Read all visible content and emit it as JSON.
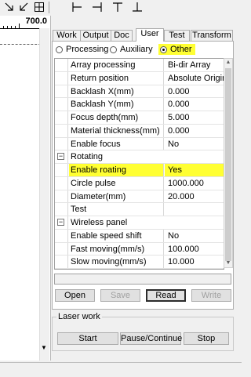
{
  "toolbar": {
    "icons": [
      "arrow-down-right-icon",
      "arrow-down-left-icon",
      "grid-icon",
      "align-left-icon",
      "align-right-icon",
      "align-top-icon",
      "align-bottom-icon"
    ]
  },
  "canvas": {
    "ruler_label": "700.0"
  },
  "tabs": [
    {
      "label": "Work"
    },
    {
      "label": "Output"
    },
    {
      "label": "Doc"
    },
    {
      "label": "User"
    },
    {
      "label": "Test"
    },
    {
      "label": "Transform"
    }
  ],
  "active_tab": "User",
  "radios": {
    "processing": "Processing",
    "auxiliary": "Auxiliary",
    "other": "Other",
    "selected": "Other"
  },
  "params": {
    "rows": [
      {
        "name": "Array processing",
        "value": "Bi-dir Array"
      },
      {
        "name": "Return position",
        "value": "Absolute Origin"
      },
      {
        "name": "Backlash X(mm)",
        "value": "0.000"
      },
      {
        "name": "Backlash Y(mm)",
        "value": "0.000"
      },
      {
        "name": "Focus depth(mm)",
        "value": "5.000"
      },
      {
        "name": "Material thickness(mm)",
        "value": "0.000"
      },
      {
        "name": "Enable focus",
        "value": "No"
      },
      {
        "group": "Rotating"
      },
      {
        "name": "Enable roating",
        "value": "Yes",
        "highlight": true
      },
      {
        "name": "Circle pulse",
        "value": "1000.000"
      },
      {
        "name": "Diameter(mm)",
        "value": "20.000"
      },
      {
        "name": "Test",
        "value": ""
      },
      {
        "group": "Wireless panel"
      },
      {
        "name": "Enable speed shift",
        "value": "No"
      },
      {
        "name": "Fast moving(mm/s)",
        "value": "100.000"
      },
      {
        "name": "Slow moving(mm/s)",
        "value": "10.000"
      }
    ]
  },
  "actions": {
    "open": "Open",
    "save": "Save",
    "read": "Read",
    "write": "Write"
  },
  "laser_work": {
    "title": "Laser work",
    "start": "Start",
    "pause": "Pause/Continue",
    "stop": "Stop"
  },
  "colors": {
    "highlight": "#ffff33"
  }
}
